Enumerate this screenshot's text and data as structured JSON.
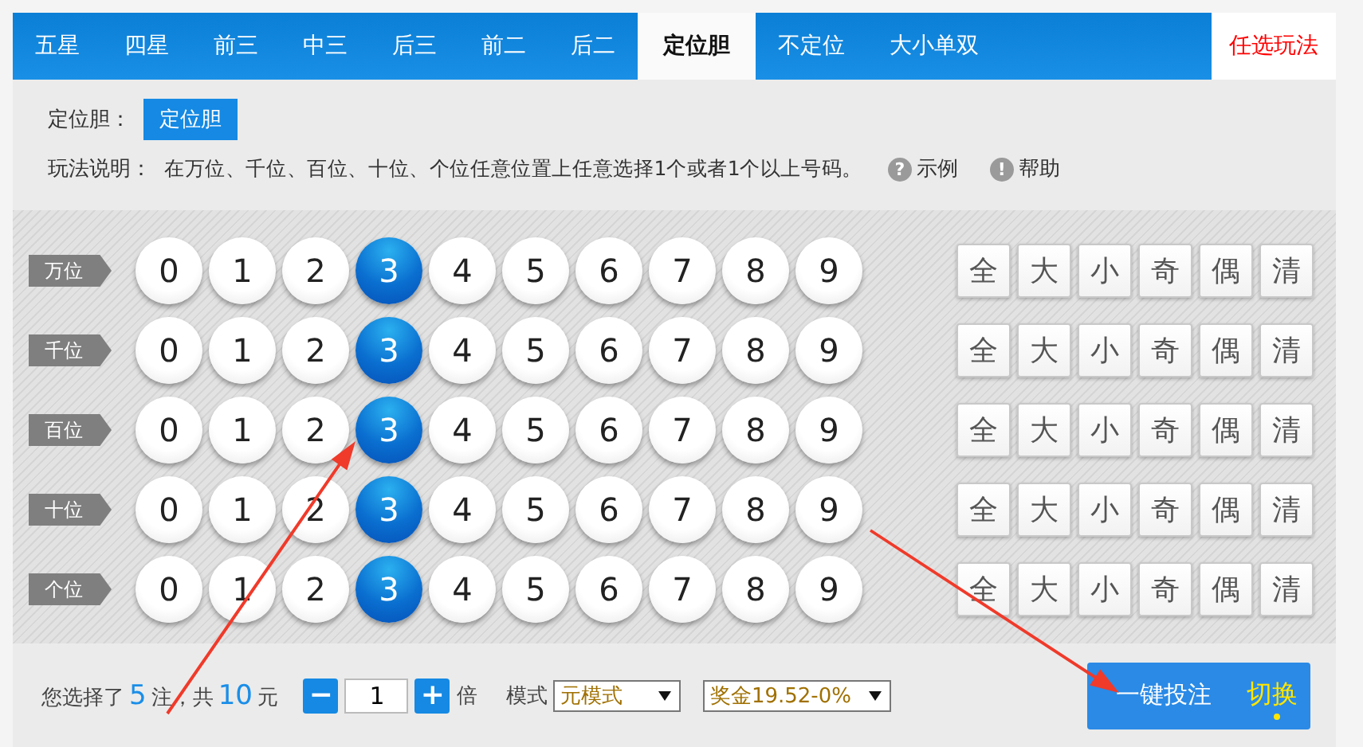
{
  "tabs": [
    {
      "label": "五星",
      "selected": false
    },
    {
      "label": "四星",
      "selected": false
    },
    {
      "label": "前三",
      "selected": false
    },
    {
      "label": "中三",
      "selected": false
    },
    {
      "label": "后三",
      "selected": false
    },
    {
      "label": "前二",
      "selected": false
    },
    {
      "label": "后二",
      "selected": false
    },
    {
      "label": "定位胆",
      "selected": true
    },
    {
      "label": "不定位",
      "selected": false
    },
    {
      "label": "大小单双",
      "selected": false
    }
  ],
  "side_tab": {
    "label": "任选玩法"
  },
  "play_type": {
    "label": "定位胆：",
    "options": [
      {
        "label": "定位胆",
        "selected": true
      }
    ]
  },
  "description": {
    "label": "玩法说明：",
    "text": "在万位、千位、百位、十位、个位任意位置上任意选择1个或者1个以上号码。"
  },
  "help_links": [
    {
      "icon": "?",
      "label": "示例"
    },
    {
      "icon": "!",
      "label": "帮助"
    }
  ],
  "rows": [
    {
      "label": "万位",
      "balls": [
        {
          "digit": "0",
          "selected": false
        },
        {
          "digit": "1",
          "selected": false
        },
        {
          "digit": "2",
          "selected": false
        },
        {
          "digit": "3",
          "selected": true
        },
        {
          "digit": "4",
          "selected": false
        },
        {
          "digit": "5",
          "selected": false
        },
        {
          "digit": "6",
          "selected": false
        },
        {
          "digit": "7",
          "selected": false
        },
        {
          "digit": "8",
          "selected": false
        },
        {
          "digit": "9",
          "selected": false
        }
      ],
      "quick": [
        "全",
        "大",
        "小",
        "奇",
        "偶",
        "清"
      ]
    },
    {
      "label": "千位",
      "balls": [
        {
          "digit": "0",
          "selected": false
        },
        {
          "digit": "1",
          "selected": false
        },
        {
          "digit": "2",
          "selected": false
        },
        {
          "digit": "3",
          "selected": true
        },
        {
          "digit": "4",
          "selected": false
        },
        {
          "digit": "5",
          "selected": false
        },
        {
          "digit": "6",
          "selected": false
        },
        {
          "digit": "7",
          "selected": false
        },
        {
          "digit": "8",
          "selected": false
        },
        {
          "digit": "9",
          "selected": false
        }
      ],
      "quick": [
        "全",
        "大",
        "小",
        "奇",
        "偶",
        "清"
      ]
    },
    {
      "label": "百位",
      "balls": [
        {
          "digit": "0",
          "selected": false
        },
        {
          "digit": "1",
          "selected": false
        },
        {
          "digit": "2",
          "selected": false
        },
        {
          "digit": "3",
          "selected": true
        },
        {
          "digit": "4",
          "selected": false
        },
        {
          "digit": "5",
          "selected": false
        },
        {
          "digit": "6",
          "selected": false
        },
        {
          "digit": "7",
          "selected": false
        },
        {
          "digit": "8",
          "selected": false
        },
        {
          "digit": "9",
          "selected": false
        }
      ],
      "quick": [
        "全",
        "大",
        "小",
        "奇",
        "偶",
        "清"
      ]
    },
    {
      "label": "十位",
      "balls": [
        {
          "digit": "0",
          "selected": false
        },
        {
          "digit": "1",
          "selected": false
        },
        {
          "digit": "2",
          "selected": false
        },
        {
          "digit": "3",
          "selected": true
        },
        {
          "digit": "4",
          "selected": false
        },
        {
          "digit": "5",
          "selected": false
        },
        {
          "digit": "6",
          "selected": false
        },
        {
          "digit": "7",
          "selected": false
        },
        {
          "digit": "8",
          "selected": false
        },
        {
          "digit": "9",
          "selected": false
        }
      ],
      "quick": [
        "全",
        "大",
        "小",
        "奇",
        "偶",
        "清"
      ]
    },
    {
      "label": "个位",
      "balls": [
        {
          "digit": "0",
          "selected": false
        },
        {
          "digit": "1",
          "selected": false
        },
        {
          "digit": "2",
          "selected": false
        },
        {
          "digit": "3",
          "selected": true
        },
        {
          "digit": "4",
          "selected": false
        },
        {
          "digit": "5",
          "selected": false
        },
        {
          "digit": "6",
          "selected": false
        },
        {
          "digit": "7",
          "selected": false
        },
        {
          "digit": "8",
          "selected": false
        },
        {
          "digit": "9",
          "selected": false
        }
      ],
      "quick": [
        "全",
        "大",
        "小",
        "奇",
        "偶",
        "清"
      ]
    }
  ],
  "footer": {
    "prefix": "您选择了",
    "count": "5",
    "mid": "注，共",
    "amount": "10",
    "suffix": "元",
    "minus": "−",
    "multiplier": "1",
    "plus": "+",
    "times": "倍",
    "mode_label": "模式",
    "mode": "元模式",
    "prize": "奖金19.52-0%",
    "submit": "一键投注",
    "switch": "切换"
  }
}
